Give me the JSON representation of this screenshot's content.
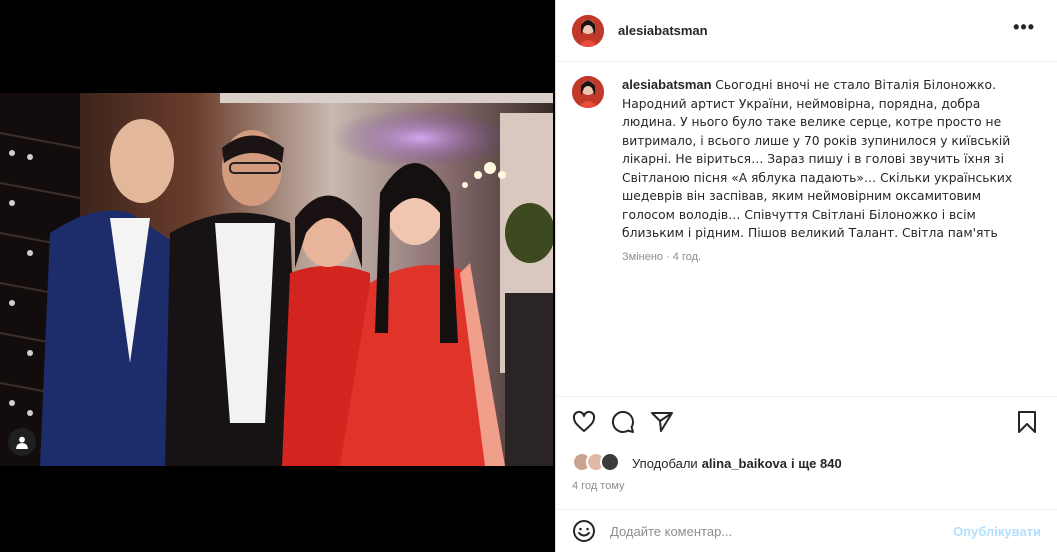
{
  "post": {
    "username": "alesiabatsman",
    "more_label": "•••",
    "caption_username": "alesiabatsman",
    "caption_text": "Сьогодні вночі не стало Віталія Білоножко. Народний артист України, неймовірна, порядна, добра людина. У нього було таке велике серце, котре просто не витримало, і всього лише у 70 років зупинилося у київській лікарні. Не віриться… Зараз пишу і в голові звучить їхня зі Світланою пісня «А яблука падають»… Скільки українських шедеврів він заспівав, яким неймовірним оксамитовим голосом володів… Співчуття Світлані Білоножко і всім близьким і рідним. Пішов великий Талант. Світла пам'ять",
    "edited_label": "Змінено · 4 год.",
    "likes_prefix": "Уподобали ",
    "likes_user": "alina_baikova",
    "likes_suffix": " і ще 840",
    "timestamp": "4 год тому",
    "comment_placeholder": "Додайте коментар...",
    "publish_label": "Опублікувати"
  },
  "icons": {
    "like": "heart-icon",
    "comment": "comment-icon",
    "share": "paper-plane-icon",
    "save": "bookmark-icon",
    "emoji": "smiley-icon",
    "tag": "user-tag-icon",
    "more": "more-dots-icon"
  },
  "colors": {
    "text": "#262626",
    "secondary": "#8e8e8e",
    "publish_disabled": "#b2dffc",
    "media_bg": "#000000",
    "divider": "#efefef"
  }
}
